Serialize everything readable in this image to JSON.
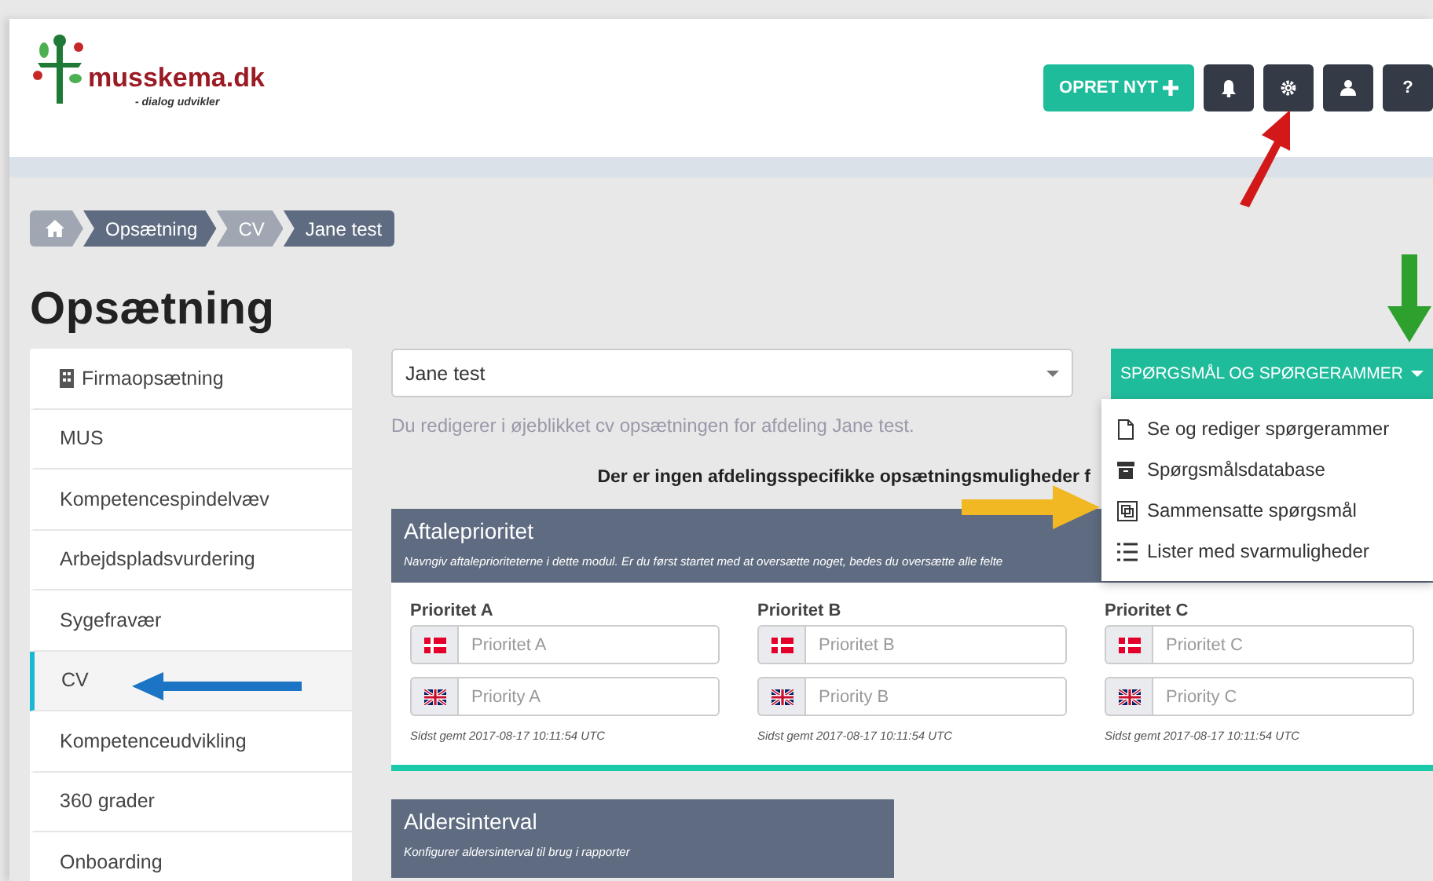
{
  "logo": {
    "name": "musskema.dk",
    "tagline": "- dialog udvikler"
  },
  "header_buttons": [
    {
      "kind": "create",
      "label": "OPRET NYT"
    },
    {
      "kind": "bell"
    },
    {
      "kind": "gear"
    },
    {
      "kind": "user"
    },
    {
      "kind": "help",
      "label": "?"
    }
  ],
  "breadcrumb": [
    {
      "kind": "home"
    },
    {
      "label": "Opsætning"
    },
    {
      "label": "CV"
    },
    {
      "label": "Jane test"
    }
  ],
  "page_title": "Opsætning",
  "sidebar": {
    "items": [
      {
        "label": "Firmaopsætning",
        "selected": false
      },
      {
        "label": "MUS",
        "selected": false
      },
      {
        "label": "Kompetencespindelvæv",
        "selected": false
      },
      {
        "label": "Arbejdspladsvurdering",
        "selected": false
      },
      {
        "label": "Sygefravær",
        "selected": false
      },
      {
        "label": "CV",
        "selected": true
      },
      {
        "label": "Kompetenceudvikling",
        "selected": false
      },
      {
        "label": "360 grader",
        "selected": false
      },
      {
        "label": "Onboarding",
        "selected": false
      }
    ]
  },
  "department_select": {
    "value": "Jane test"
  },
  "editing_note": "Du redigerer i øjeblikket cv opsætningen for afdeling Jane test.",
  "menu_button": {
    "label": "SPØRGSMÅL OG SPØRGERAMMER",
    "expanded": true
  },
  "menu": [
    {
      "label": "Se og rediger spørgerammer"
    },
    {
      "label": "Spørgsmålsdatabase"
    },
    {
      "label": "Sammensatte spørgsmål"
    },
    {
      "label": "Lister med svarmuligheder"
    }
  ],
  "notice": "Der er ingen afdelingsspecifikke opsætningsmuligheder f",
  "panels": [
    {
      "title": "Aftaleprioritet",
      "description": "Navngiv aftaleprioriteterne i dette modul. Er du først startet med at oversætte noget, bedes du oversætte alle felte",
      "fields": [
        {
          "label": "Prioritet A",
          "inputs": [
            {
              "placeholder": "Prioritet A"
            },
            {
              "placeholder": "Priority A"
            }
          ],
          "saved": "Sidst gemt 2017-08-17 10:11:54 UTC"
        },
        {
          "label": "Prioritet B",
          "inputs": [
            {
              "placeholder": "Prioritet B"
            },
            {
              "placeholder": "Priority B"
            }
          ],
          "saved": "Sidst gemt 2017-08-17 10:11:54 UTC"
        },
        {
          "label": "Prioritet C",
          "inputs": [
            {
              "placeholder": "Prioritet C"
            },
            {
              "placeholder": "Priority C"
            }
          ],
          "saved": "Sidst gemt 2017-08-17 10:11:54 UTC"
        }
      ]
    },
    {
      "title": "Aldersinterval",
      "description": "Konfigurer aldersinterval til brug i rapporter"
    }
  ]
}
